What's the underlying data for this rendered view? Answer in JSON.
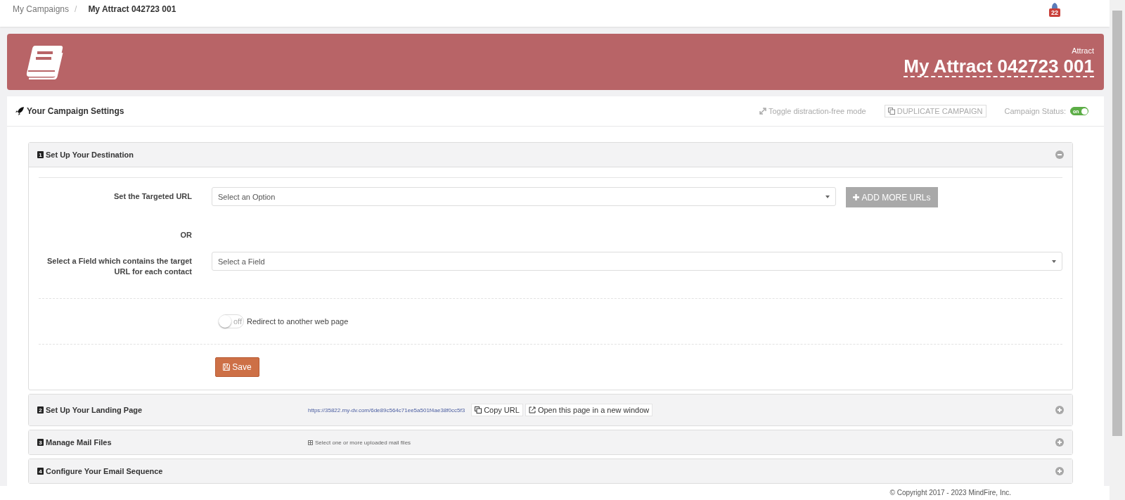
{
  "breadcrumb": [
    {
      "label": "My Campaigns",
      "current": false
    },
    {
      "label": "My Attract 042723 001",
      "current": true
    }
  ],
  "breadcrumb_separator": "/",
  "notification_count": "22",
  "banner": {
    "type": "Attract",
    "title": "My Attract 042723 001"
  },
  "settings": {
    "title": "Your Campaign Settings",
    "toggle_mode": "Toggle distraction-free mode",
    "duplicate_button": "DUPLICATE CAMPAIGN",
    "status_label": "Campaign Status:",
    "status": {
      "on": true,
      "label": "on"
    }
  },
  "sections": [
    {
      "number": "1",
      "title": "Set Up Your Destination",
      "expanded": true
    },
    {
      "number": "2",
      "title": "Set Up Your Landing Page",
      "expanded": false,
      "url": "https://35822.my-dv.com/6de89c564c71ee5a501f4ae38f0cc5f3",
      "copy_button": "Copy URL",
      "open_button": "Open this page in a new window"
    },
    {
      "number": "3",
      "title": "Manage Mail Files",
      "expanded": false,
      "hint": "Select one or more uploaded mail files"
    },
    {
      "number": "4",
      "title": "Configure Your Email Sequence",
      "expanded": false
    }
  ],
  "destination": {
    "url_label": "Set the Targeted URL",
    "url_placeholder": "Select an Option",
    "add_button": "ADD MORE URLs",
    "or": "OR",
    "field_label": "Select a Field which contains the target URL for each contact",
    "field_placeholder": "Select a Field",
    "redirect": {
      "on": false,
      "label": "off",
      "text": "Redirect to another web page"
    },
    "save_button": "Save"
  },
  "footer": "© Copyright 2017 - 2023 MindFire, Inc."
}
